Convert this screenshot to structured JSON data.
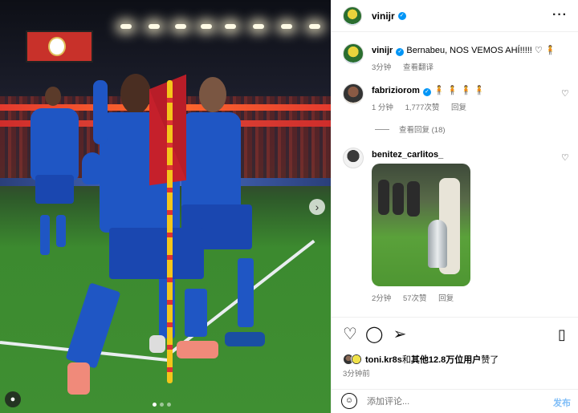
{
  "post": {
    "username": "vinijr",
    "more_icon": "more-icon",
    "caption_username": "vinijr",
    "caption_text": "Bernabeu, NOS VEMOS AHÍ!!!!! ♡ 🧍",
    "caption_time": "3分钟",
    "caption_translate": "查看翻译"
  },
  "comments": [
    {
      "username": "fabriziorom",
      "text": "🧍 🧍 🧍 🧍",
      "time": "1 分钟",
      "likes": "1,777次赞",
      "reply": "回复",
      "view_replies": "查看回复 (18)"
    },
    {
      "username": "benitez_carlitos_",
      "text": "",
      "time": "2分钟",
      "likes": "57次赞",
      "reply": "回复"
    }
  ],
  "actions": {
    "liked_by_user": "toni.kr8s",
    "liked_by_joiner": "和",
    "liked_by_others": "其他12.8万位用户",
    "liked_by_suffix": "赞了",
    "time_ago": "3分钟前"
  },
  "composer": {
    "placeholder": "添加评论...",
    "post_label": "发布"
  },
  "media": {
    "next_icon": "chevron-right-icon",
    "carousel_total": 3,
    "carousel_active": 1
  },
  "colors": {
    "verified": "#0095f6",
    "post_button": "#7fbdf7",
    "meta_text": "#737373"
  }
}
